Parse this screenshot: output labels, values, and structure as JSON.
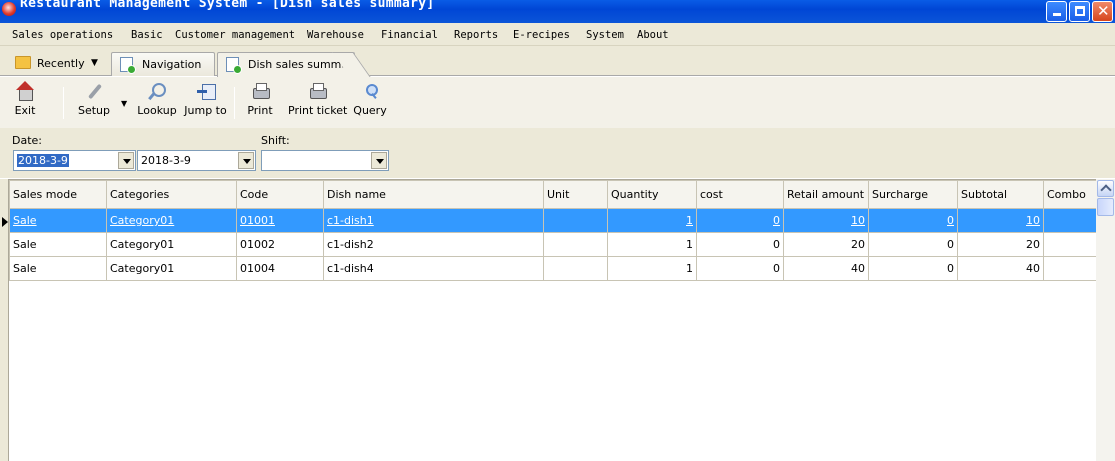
{
  "window": {
    "title": "Restaurant Management System - [Dish sales summary]"
  },
  "menu": [
    "Sales operations",
    "Basic",
    "Customer management",
    "Warehouse",
    "Financial",
    "Reports",
    "E-recipes",
    "System",
    "About"
  ],
  "tabs": {
    "recently": "Recently",
    "navigation": "Navigation",
    "dish_sales": "Dish sales summary"
  },
  "toolbar": {
    "exit": "Exit",
    "setup": "Setup",
    "lookup": "Lookup",
    "jump_to": "Jump to",
    "print": "Print",
    "print_ticket": "Print ticket",
    "query": "Query"
  },
  "filters": {
    "date_label": "Date:",
    "shift_label": "Shift:",
    "date_from": "2018-3-9",
    "date_to": "2018-3-9",
    "shift": ""
  },
  "grid": {
    "columns": [
      "Sales mode",
      "Categories",
      "Code",
      "Dish name",
      "Unit",
      "Quantity",
      "cost",
      "Retail amount",
      "Surcharge",
      "Subtotal",
      "Combo"
    ],
    "rows": [
      {
        "sales_mode": "Sale",
        "category": "Category01",
        "code": "01001",
        "dish": "c1-dish1",
        "unit": "",
        "quantity": "1",
        "cost": "0",
        "retail": "10",
        "surcharge": "0",
        "subtotal": "10",
        "combo": ""
      },
      {
        "sales_mode": "Sale",
        "category": "Category01",
        "code": "01002",
        "dish": "c1-dish2",
        "unit": "",
        "quantity": "1",
        "cost": "0",
        "retail": "20",
        "surcharge": "0",
        "subtotal": "20",
        "combo": ""
      },
      {
        "sales_mode": "Sale",
        "category": "Category01",
        "code": "01004",
        "dish": "c1-dish4",
        "unit": "",
        "quantity": "1",
        "cost": "0",
        "retail": "40",
        "surcharge": "0",
        "subtotal": "40",
        "combo": ""
      }
    ]
  },
  "colors": {
    "titlebar": "#0046d5",
    "selection": "#3399ff",
    "chrome": "#ece9d8"
  }
}
